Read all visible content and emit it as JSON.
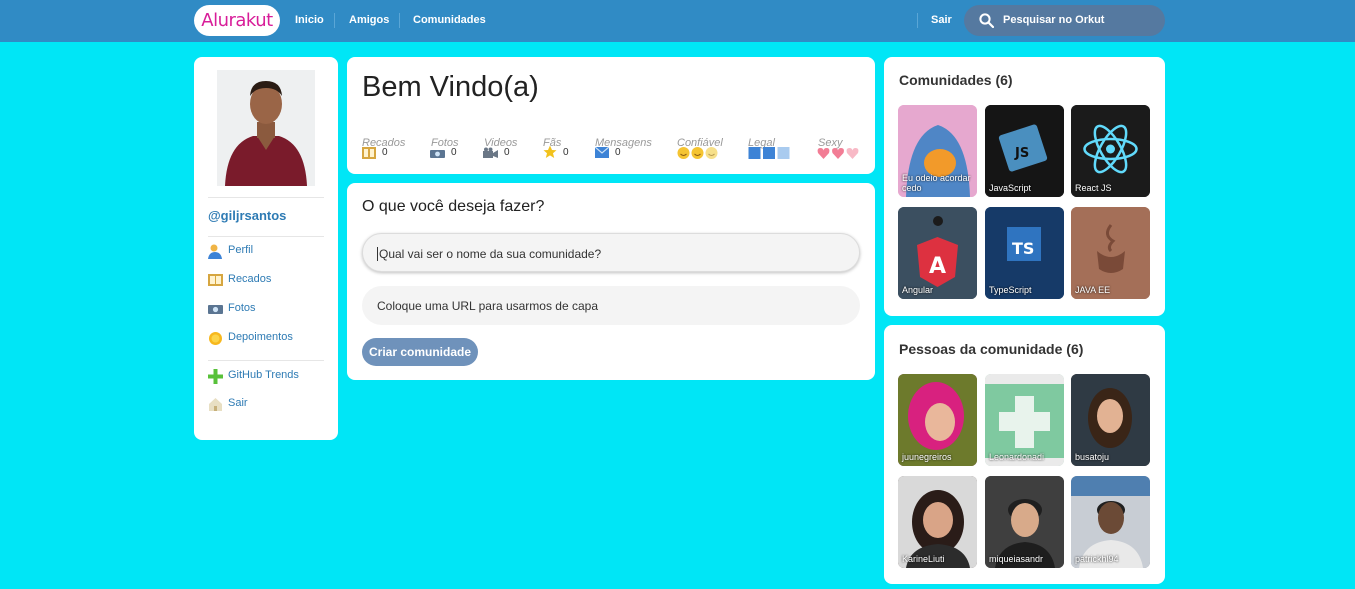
{
  "header": {
    "logo": "Alurakut",
    "nav": [
      "Inicio",
      "Amigos",
      "Comunidades"
    ],
    "logout": "Sair",
    "search_placeholder": "Pesquisar no Orkut"
  },
  "profile": {
    "username": "@giljrsantos",
    "menu": [
      {
        "label": "Perfil",
        "icon": "user-icon"
      },
      {
        "label": "Recados",
        "icon": "book-icon"
      },
      {
        "label": "Fotos",
        "icon": "camera-icon"
      },
      {
        "label": "Depoimentos",
        "icon": "sun-icon"
      }
    ],
    "menu2": [
      {
        "label": "GitHub Trends",
        "icon": "plus-icon"
      },
      {
        "label": "Sair",
        "icon": "logout-icon"
      }
    ]
  },
  "welcome": {
    "title": "Bem Vindo(a)",
    "stats": [
      {
        "label": "Recados",
        "value": "0",
        "icon": "book-icon"
      },
      {
        "label": "Fotos",
        "value": "0",
        "icon": "camera-icon"
      },
      {
        "label": "Videos",
        "value": "0",
        "icon": "video-icon"
      },
      {
        "label": "Fãs",
        "value": "0",
        "icon": "star-icon"
      },
      {
        "label": "Mensagens",
        "value": "0",
        "icon": "mail-icon"
      },
      {
        "label": "Confiável",
        "level": 2,
        "icon": "smile-icon"
      },
      {
        "label": "Legal",
        "level": 2,
        "icon": "cube-icon"
      },
      {
        "label": "Sexy",
        "level": 2,
        "icon": "heart-icon"
      }
    ]
  },
  "form": {
    "title": "O que você deseja fazer?",
    "name_placeholder": "Qual vai ser o nome da sua comunidade?",
    "url_placeholder": "Coloque uma URL para usarmos de capa",
    "submit": "Criar comunidade"
  },
  "communities": {
    "title": "Comunidades (6)",
    "items": [
      {
        "name": "Eu odeio acordar cedo",
        "color": "#5a8fc9"
      },
      {
        "name": "JavaScript",
        "color": "#111111"
      },
      {
        "name": "React JS",
        "color": "#1a1a1a"
      },
      {
        "name": "Angular",
        "color": "#3f5566"
      },
      {
        "name": "TypeScript",
        "color": "#163a68"
      },
      {
        "name": "JAVA EE",
        "color": "#9c6a55"
      }
    ]
  },
  "people": {
    "title": "Pessoas da comunidade (6)",
    "items": [
      {
        "name": "juunegreiros",
        "color": "#8a3a6c"
      },
      {
        "name": "Leonardonadi",
        "color": "#9ad2b4"
      },
      {
        "name": "busatoju",
        "color": "#3a2f2a"
      },
      {
        "name": "KarineLiuti",
        "color": "#5c4a48"
      },
      {
        "name": "miqueiasandr",
        "color": "#4c4c4c"
      },
      {
        "name": "patrickhl94",
        "color": "#7b7f88"
      }
    ]
  },
  "colors": {
    "background": "#00e6f6",
    "topbar": "#308bc5",
    "link": "#2e7bb4",
    "button": "#6f92bb"
  }
}
